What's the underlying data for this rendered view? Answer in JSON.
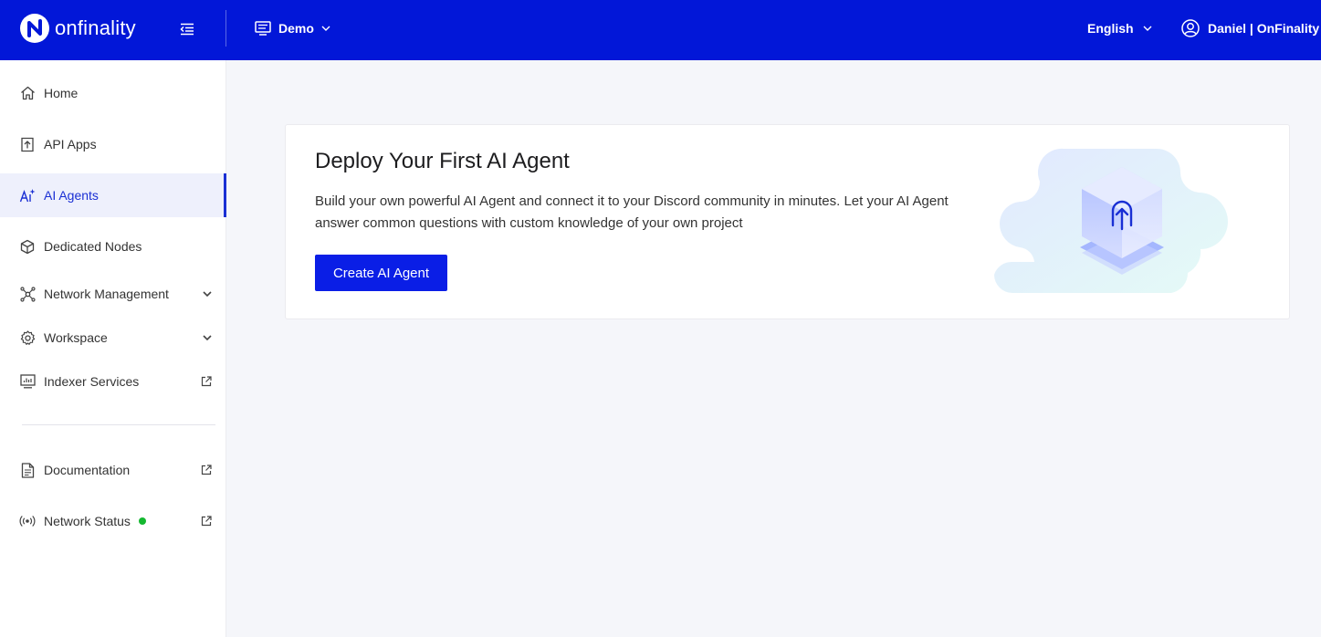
{
  "header": {
    "brand": "onfinality",
    "project": "Demo",
    "language": "English",
    "user": "Daniel | OnFinality"
  },
  "sidebar": {
    "items": [
      {
        "label": "Home",
        "icon": "home-icon"
      },
      {
        "label": "API Apps",
        "icon": "api-upload-icon"
      },
      {
        "label": "AI Agents",
        "icon": "ai-sparkle-icon",
        "active": true
      },
      {
        "label": "Dedicated Nodes",
        "icon": "cube-icon"
      },
      {
        "label": "Network Management",
        "icon": "network-icon",
        "expandable": true
      },
      {
        "label": "Workspace",
        "icon": "gear-icon",
        "expandable": true
      },
      {
        "label": "Indexer Services",
        "icon": "monitor-icon",
        "external": true
      }
    ],
    "bottom_items": [
      {
        "label": "Documentation",
        "icon": "document-icon",
        "external": true
      },
      {
        "label": "Network Status",
        "icon": "broadcast-icon",
        "external": true,
        "status": "online"
      }
    ]
  },
  "main": {
    "title": "Deploy Your First AI Agent",
    "description": "Build your own powerful AI Agent and connect it to your Discord community in minutes. Let your AI Agent answer common questions with custom knowledge of your own project",
    "cta_label": "Create AI Agent"
  },
  "colors": {
    "header_bg": "#0217d8",
    "accent": "#0a1ee6",
    "active_bg": "#eef0fc",
    "status_online": "#14b830",
    "page_bg": "#f5f6fa"
  }
}
